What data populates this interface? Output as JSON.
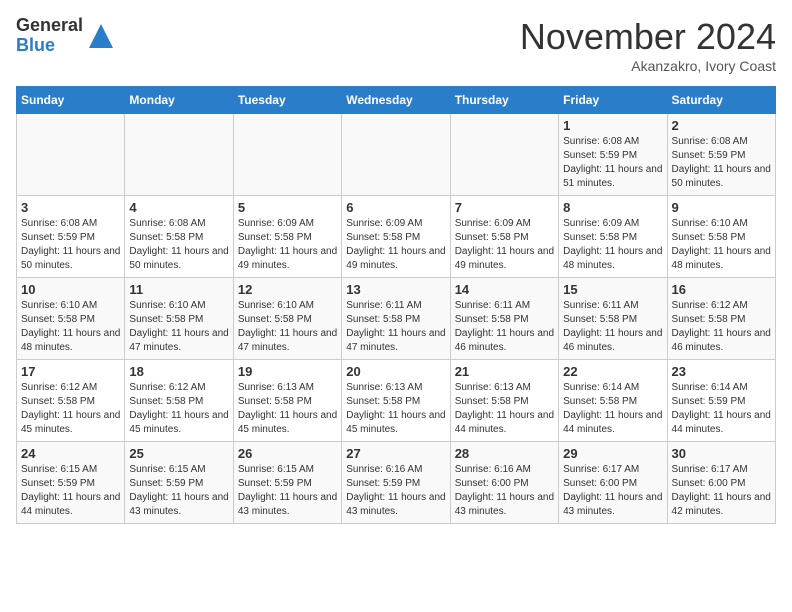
{
  "header": {
    "logo": {
      "general": "General",
      "blue": "Blue"
    },
    "title": "November 2024",
    "location": "Akanzakro, Ivory Coast"
  },
  "calendar": {
    "days_of_week": [
      "Sunday",
      "Monday",
      "Tuesday",
      "Wednesday",
      "Thursday",
      "Friday",
      "Saturday"
    ],
    "weeks": [
      [
        {
          "day": "",
          "info": ""
        },
        {
          "day": "",
          "info": ""
        },
        {
          "day": "",
          "info": ""
        },
        {
          "day": "",
          "info": ""
        },
        {
          "day": "",
          "info": ""
        },
        {
          "day": "1",
          "info": "Sunrise: 6:08 AM\nSunset: 5:59 PM\nDaylight: 11 hours and 51 minutes."
        },
        {
          "day": "2",
          "info": "Sunrise: 6:08 AM\nSunset: 5:59 PM\nDaylight: 11 hours and 50 minutes."
        }
      ],
      [
        {
          "day": "3",
          "info": "Sunrise: 6:08 AM\nSunset: 5:59 PM\nDaylight: 11 hours and 50 minutes."
        },
        {
          "day": "4",
          "info": "Sunrise: 6:08 AM\nSunset: 5:58 PM\nDaylight: 11 hours and 50 minutes."
        },
        {
          "day": "5",
          "info": "Sunrise: 6:09 AM\nSunset: 5:58 PM\nDaylight: 11 hours and 49 minutes."
        },
        {
          "day": "6",
          "info": "Sunrise: 6:09 AM\nSunset: 5:58 PM\nDaylight: 11 hours and 49 minutes."
        },
        {
          "day": "7",
          "info": "Sunrise: 6:09 AM\nSunset: 5:58 PM\nDaylight: 11 hours and 49 minutes."
        },
        {
          "day": "8",
          "info": "Sunrise: 6:09 AM\nSunset: 5:58 PM\nDaylight: 11 hours and 48 minutes."
        },
        {
          "day": "9",
          "info": "Sunrise: 6:10 AM\nSunset: 5:58 PM\nDaylight: 11 hours and 48 minutes."
        }
      ],
      [
        {
          "day": "10",
          "info": "Sunrise: 6:10 AM\nSunset: 5:58 PM\nDaylight: 11 hours and 48 minutes."
        },
        {
          "day": "11",
          "info": "Sunrise: 6:10 AM\nSunset: 5:58 PM\nDaylight: 11 hours and 47 minutes."
        },
        {
          "day": "12",
          "info": "Sunrise: 6:10 AM\nSunset: 5:58 PM\nDaylight: 11 hours and 47 minutes."
        },
        {
          "day": "13",
          "info": "Sunrise: 6:11 AM\nSunset: 5:58 PM\nDaylight: 11 hours and 47 minutes."
        },
        {
          "day": "14",
          "info": "Sunrise: 6:11 AM\nSunset: 5:58 PM\nDaylight: 11 hours and 46 minutes."
        },
        {
          "day": "15",
          "info": "Sunrise: 6:11 AM\nSunset: 5:58 PM\nDaylight: 11 hours and 46 minutes."
        },
        {
          "day": "16",
          "info": "Sunrise: 6:12 AM\nSunset: 5:58 PM\nDaylight: 11 hours and 46 minutes."
        }
      ],
      [
        {
          "day": "17",
          "info": "Sunrise: 6:12 AM\nSunset: 5:58 PM\nDaylight: 11 hours and 45 minutes."
        },
        {
          "day": "18",
          "info": "Sunrise: 6:12 AM\nSunset: 5:58 PM\nDaylight: 11 hours and 45 minutes."
        },
        {
          "day": "19",
          "info": "Sunrise: 6:13 AM\nSunset: 5:58 PM\nDaylight: 11 hours and 45 minutes."
        },
        {
          "day": "20",
          "info": "Sunrise: 6:13 AM\nSunset: 5:58 PM\nDaylight: 11 hours and 45 minutes."
        },
        {
          "day": "21",
          "info": "Sunrise: 6:13 AM\nSunset: 5:58 PM\nDaylight: 11 hours and 44 minutes."
        },
        {
          "day": "22",
          "info": "Sunrise: 6:14 AM\nSunset: 5:58 PM\nDaylight: 11 hours and 44 minutes."
        },
        {
          "day": "23",
          "info": "Sunrise: 6:14 AM\nSunset: 5:59 PM\nDaylight: 11 hours and 44 minutes."
        }
      ],
      [
        {
          "day": "24",
          "info": "Sunrise: 6:15 AM\nSunset: 5:59 PM\nDaylight: 11 hours and 44 minutes."
        },
        {
          "day": "25",
          "info": "Sunrise: 6:15 AM\nSunset: 5:59 PM\nDaylight: 11 hours and 43 minutes."
        },
        {
          "day": "26",
          "info": "Sunrise: 6:15 AM\nSunset: 5:59 PM\nDaylight: 11 hours and 43 minutes."
        },
        {
          "day": "27",
          "info": "Sunrise: 6:16 AM\nSunset: 5:59 PM\nDaylight: 11 hours and 43 minutes."
        },
        {
          "day": "28",
          "info": "Sunrise: 6:16 AM\nSunset: 6:00 PM\nDaylight: 11 hours and 43 minutes."
        },
        {
          "day": "29",
          "info": "Sunrise: 6:17 AM\nSunset: 6:00 PM\nDaylight: 11 hours and 43 minutes."
        },
        {
          "day": "30",
          "info": "Sunrise: 6:17 AM\nSunset: 6:00 PM\nDaylight: 11 hours and 42 minutes."
        }
      ]
    ]
  }
}
